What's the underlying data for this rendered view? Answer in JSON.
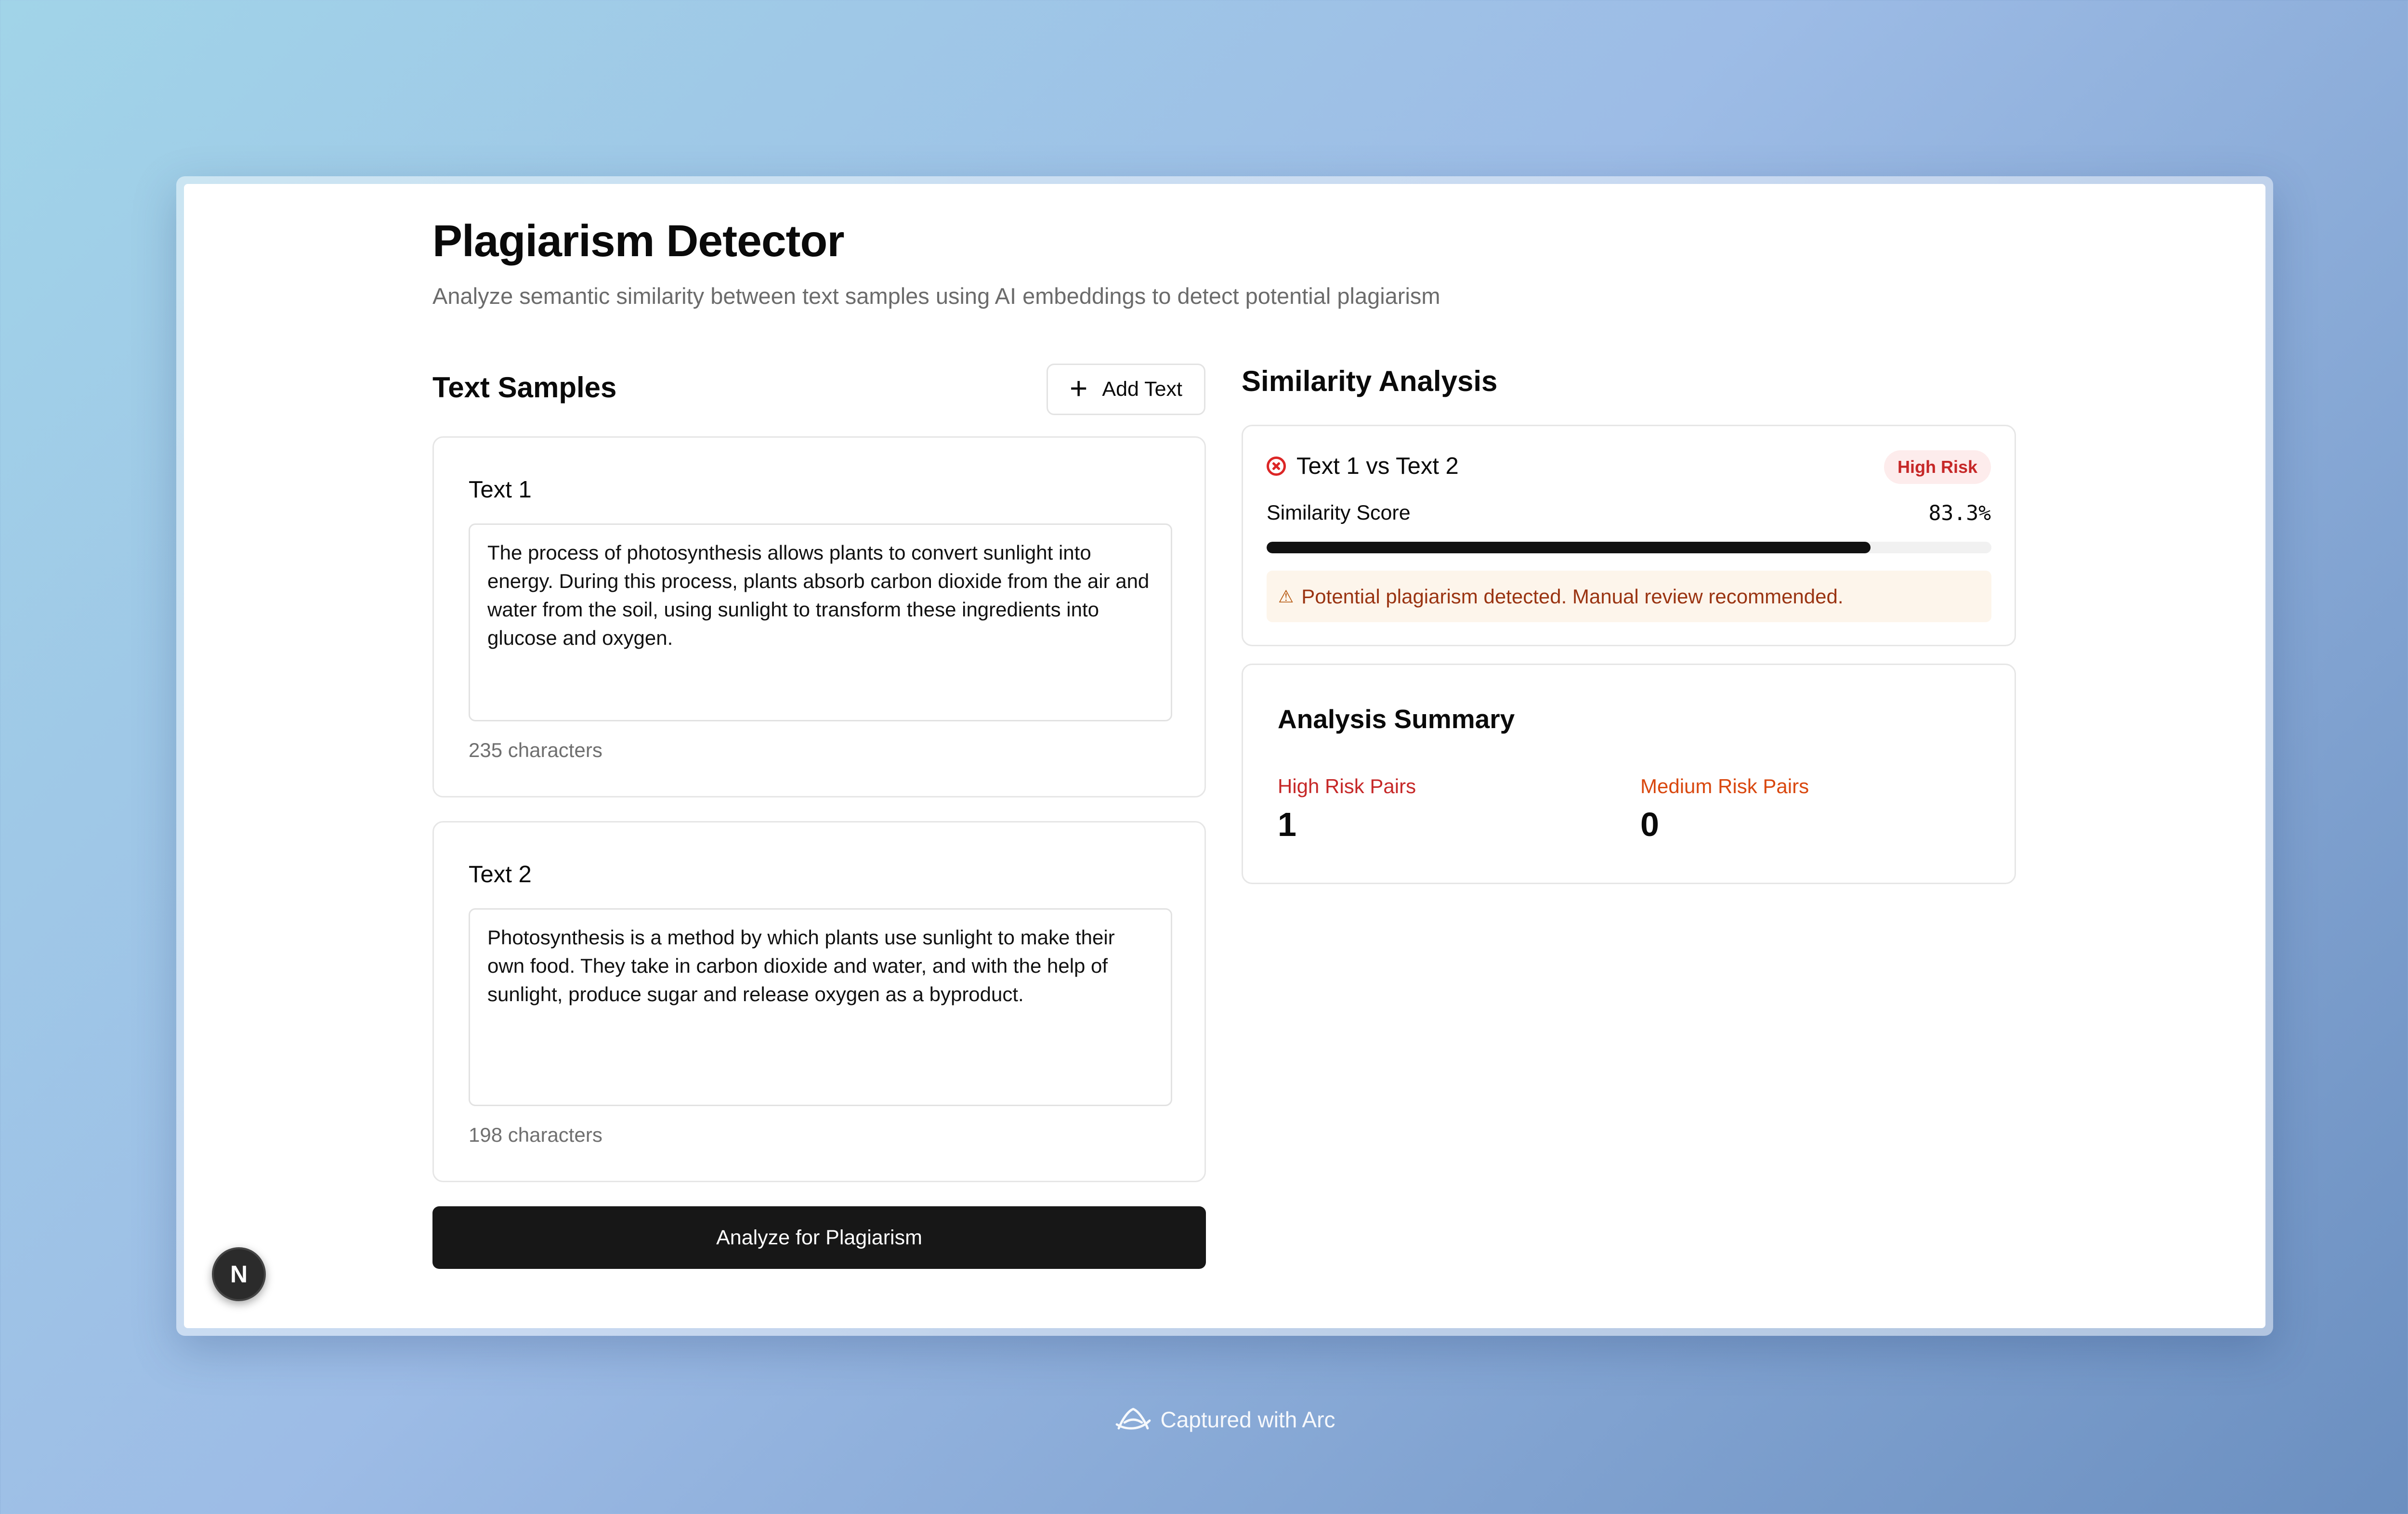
{
  "app": {
    "title": "Plagiarism Detector",
    "subtitle": "Analyze semantic similarity between text samples using AI embeddings to detect potential plagiarism"
  },
  "samples": {
    "section_title": "Text Samples",
    "add_button_label": "Add Text",
    "items": [
      {
        "label": "Text 1",
        "content": "The process of photosynthesis allows plants to convert sunlight into energy. During this process, plants absorb carbon dioxide from the air and water from the soil, using sunlight to transform these ingredients into glucose and oxygen.",
        "char_count": "235 characters"
      },
      {
        "label": "Text 2",
        "content": "Photosynthesis is a method by which plants use sunlight to make their own food. They take in carbon dioxide and water, and with the help of sunlight, produce sugar and release oxygen as a byproduct.",
        "char_count": "198 characters"
      }
    ],
    "analyze_button_label": "Analyze for Plagiarism"
  },
  "analysis": {
    "section_title": "Similarity Analysis",
    "result": {
      "pair_label": "Text 1 vs Text 2",
      "risk_badge": "High Risk",
      "score_label": "Similarity Score",
      "score_display": "83.3%",
      "score_value": 83.3,
      "warning": "Potential plagiarism detected. Manual review recommended."
    },
    "summary": {
      "title": "Analysis Summary",
      "high_risk_label": "High Risk Pairs",
      "high_risk_count": "1",
      "medium_risk_label": "Medium Risk Pairs",
      "medium_risk_count": "0"
    }
  },
  "dev_badge": {
    "letter": "N"
  },
  "footer": {
    "caption": "Captured with Arc"
  },
  "colors": {
    "high_risk": "#c62828",
    "medium_risk": "#d9480f",
    "primary_button": "#171717",
    "warning_bg": "#fdf5eb",
    "warning_text": "#9a3412"
  },
  "icons": [
    "plus-icon",
    "x-circle-icon",
    "warning-triangle-icon",
    "arc-logo-icon"
  ]
}
